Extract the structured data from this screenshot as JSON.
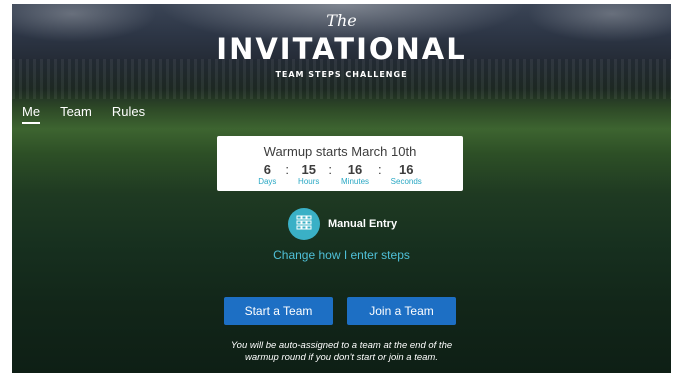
{
  "header": {
    "title_prefix": "The",
    "title": "INVITATIONAL",
    "subtitle": "TEAM STEPS CHALLENGE"
  },
  "nav": {
    "items": [
      {
        "label": "Me",
        "active": true
      },
      {
        "label": "Team",
        "active": false
      },
      {
        "label": "Rules",
        "active": false
      }
    ]
  },
  "countdown": {
    "title": "Warmup starts March 10th",
    "days": {
      "value": "6",
      "label": "Days"
    },
    "hours": {
      "value": "15",
      "label": "Hours"
    },
    "minutes": {
      "value": "16",
      "label": "Minutes"
    },
    "seconds": {
      "value": "16",
      "label": "Seconds"
    },
    "separator": ":"
  },
  "entry": {
    "icon": "keypad-icon",
    "label": "Manual Entry",
    "change_link": "Change how I enter steps"
  },
  "actions": {
    "start_team": "Start a Team",
    "join_team": "Join a Team"
  },
  "footnote": {
    "line1": "You will be auto-assigned to a team at the end of the",
    "line2": "warmup round if you don't start or join a team."
  },
  "colors": {
    "accent": "#3ab0c6",
    "link": "#4fc0d8",
    "button": "#1d6fc4"
  }
}
